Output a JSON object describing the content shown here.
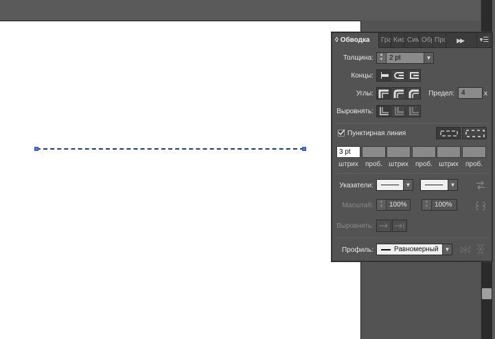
{
  "panel": {
    "tabs": [
      {
        "label": "◊ Обводка",
        "active": true
      },
      {
        "label": "Гра",
        "active": false
      },
      {
        "label": "Кис",
        "active": false
      },
      {
        "label": "Сим",
        "active": false
      },
      {
        "label": "Обр",
        "active": false
      },
      {
        "label": "Про",
        "active": false
      }
    ],
    "expand_icon": "double-chevron-right-icon",
    "menu_icon": "panel-menu-icon"
  },
  "stroke": {
    "weight_label": "Толщина:",
    "weight_value": "2 pt",
    "caps_label": "Концы:",
    "corners_label": "Углы:",
    "limit_label": "Предел:",
    "limit_value": "4",
    "limit_unit": "x",
    "align_label": "Выровнять:"
  },
  "dashed": {
    "label": "Пунктирная линия",
    "checked": true,
    "boxes": [
      {
        "value": "3 pt",
        "label": "штрих"
      },
      {
        "value": "",
        "label": "проб."
      },
      {
        "value": "",
        "label": "штрих"
      },
      {
        "value": "",
        "label": "проб."
      },
      {
        "value": "",
        "label": "штрих"
      },
      {
        "value": "",
        "label": "проб."
      }
    ]
  },
  "arrowheads": {
    "label": "Указатели:",
    "scale_label": "Масштаб:",
    "scale_start": "100%",
    "scale_end": "100%",
    "align_label": "Выровнять:"
  },
  "profile": {
    "label": "Профиль:",
    "value": "Равномерный"
  },
  "colors": {
    "panel_bg": "#535353",
    "artboard": "#ffffff",
    "path_anchor": "#4a7be8",
    "path_stroke": "#1f3a6e"
  }
}
